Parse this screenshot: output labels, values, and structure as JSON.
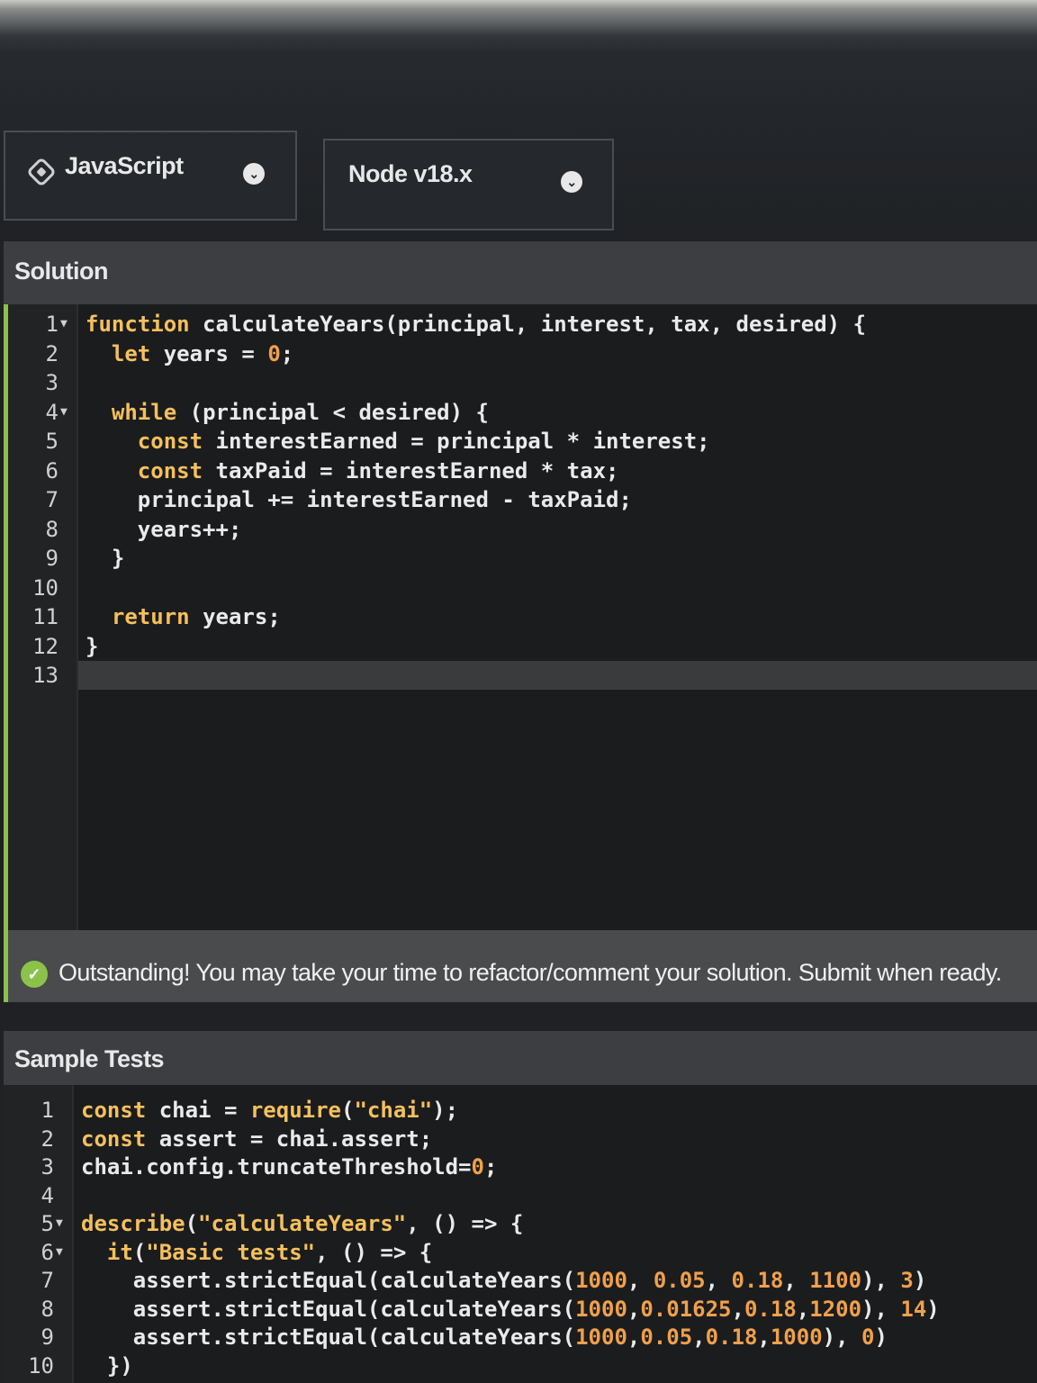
{
  "toolbar": {
    "language": "JavaScript",
    "version": "Node v18.x"
  },
  "solution": {
    "title": "Solution",
    "lines": [
      {
        "n": "1",
        "fold": true
      },
      {
        "n": "2"
      },
      {
        "n": "3"
      },
      {
        "n": "4",
        "fold": true
      },
      {
        "n": "5"
      },
      {
        "n": "6"
      },
      {
        "n": "7"
      },
      {
        "n": "8"
      },
      {
        "n": "9"
      },
      {
        "n": "10"
      },
      {
        "n": "11"
      },
      {
        "n": "12"
      },
      {
        "n": "13"
      }
    ],
    "code": [
      "function calculateYears(principal, interest, tax, desired) {",
      "  let years = 0;",
      "",
      "  while (principal < desired) {",
      "    const interestEarned = principal * interest;",
      "    const taxPaid = interestEarned * tax;",
      "    principal += interestEarned - taxPaid;",
      "    years++;",
      "  }",
      "",
      "  return years;",
      "}",
      ""
    ]
  },
  "status": {
    "message": "Outstanding! You may take your time to refactor/comment your solution. Submit when ready.",
    "color": "#8bc34a"
  },
  "tests": {
    "title": "Sample Tests",
    "lines": [
      {
        "n": "1"
      },
      {
        "n": "2"
      },
      {
        "n": "3"
      },
      {
        "n": "4"
      },
      {
        "n": "5",
        "fold": true
      },
      {
        "n": "6",
        "fold": true
      },
      {
        "n": "7"
      },
      {
        "n": "8"
      },
      {
        "n": "9"
      },
      {
        "n": "10"
      }
    ],
    "code": [
      "const chai = require(\"chai\");",
      "const assert = chai.assert;",
      "chai.config.truncateThreshold=0;",
      "",
      "describe(\"calculateYears\", () => {",
      "  it(\"Basic tests\", () => {",
      "    assert.strictEqual(calculateYears(1000, 0.05, 0.18, 1100), 3)",
      "    assert.strictEqual(calculateYears(1000,0.01625,0.18,1200), 14)",
      "    assert.strictEqual(calculateYears(1000,0.05,0.18,1000), 0)",
      "  })"
    ]
  },
  "icons": {
    "language": "node-icon",
    "dropdown": "chevron-down-icon",
    "fold": "fold-arrow-icon",
    "success": "check-circle-icon"
  }
}
